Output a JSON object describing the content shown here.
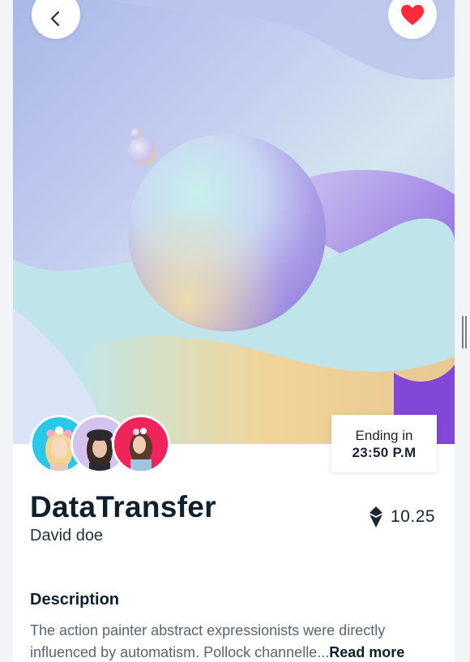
{
  "header": {
    "back_icon": "chevron-left-icon",
    "favorite_icon": "heart-icon",
    "favorite_color": "#ff2b3a"
  },
  "hero": {
    "artwork": "abstract-pastel-sphere"
  },
  "auction": {
    "ending_label": "Ending in",
    "ending_time": "23:50 P.M"
  },
  "collectors": [
    {
      "name": "avatar-1",
      "bg": "#29c7e8"
    },
    {
      "name": "avatar-2",
      "bg": "#c9b2ea"
    },
    {
      "name": "avatar-3",
      "bg": "#f0245a"
    }
  ],
  "item": {
    "title": "DataTransfer",
    "author": "David doe",
    "price": "10.25",
    "price_icon": "ethereum-icon"
  },
  "description": {
    "heading": "Description",
    "text": "The action painter abstract expressionists were directly influenced by automatism. Pollock channelle...",
    "read_more": "Read more"
  }
}
